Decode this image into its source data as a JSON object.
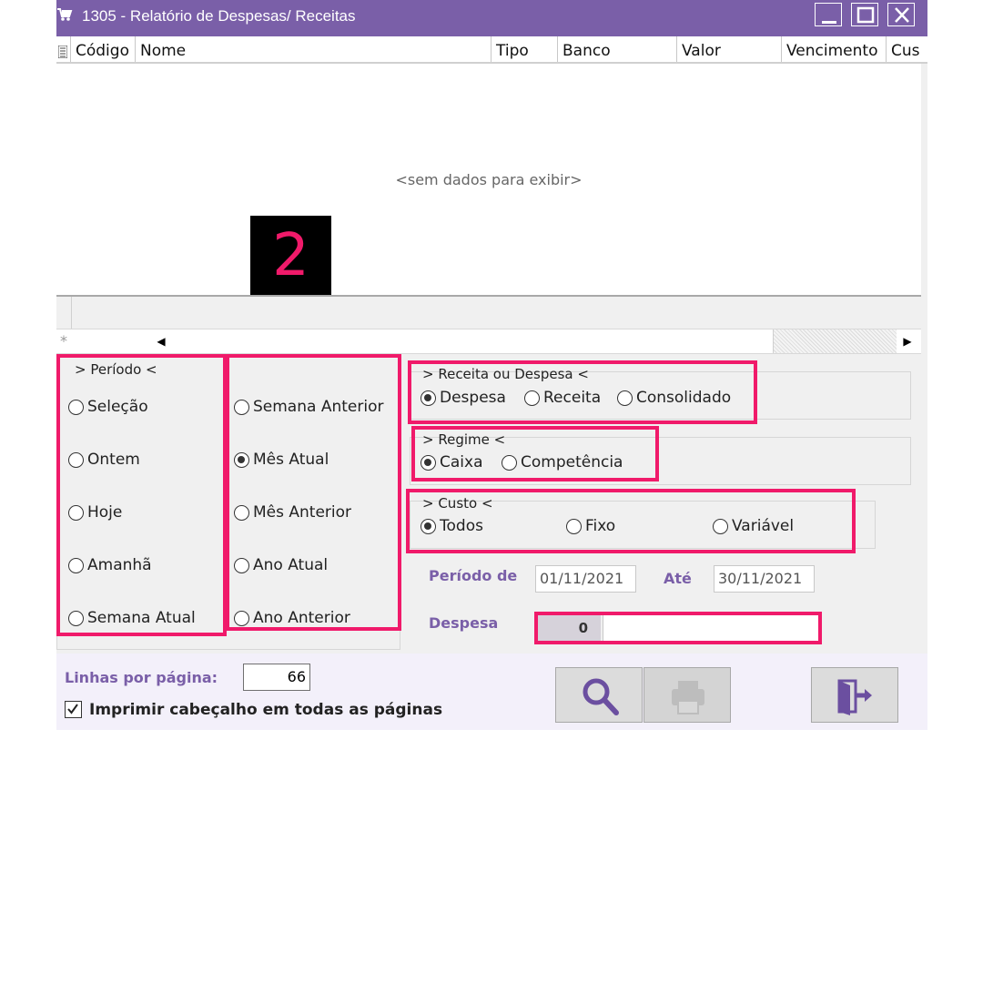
{
  "window": {
    "title": "1305 - Relatório de Despesas/ Receitas",
    "icons": [
      "cart-icon",
      "minimize-icon",
      "maximize-icon",
      "close-icon"
    ]
  },
  "grid": {
    "columns": [
      "Código",
      "Nome",
      "Tipo",
      "Banco",
      "Valor",
      "Vencimento",
      "Cus"
    ],
    "empty_message": "<sem dados para exibir>",
    "marker": "2"
  },
  "periodo": {
    "legend": "> Período <",
    "options_left": [
      "Seleção",
      "Ontem",
      "Hoje",
      "Amanhã",
      "Semana Atual"
    ],
    "options_right": [
      "Semana Anterior",
      "Mês Atual",
      "Mês Anterior",
      "Ano Atual",
      "Ano Anterior"
    ],
    "selected": "Mês Atual"
  },
  "receita_despesa": {
    "legend": "> Receita ou Despesa <",
    "options": [
      "Despesa",
      "Receita",
      "Consolidado"
    ],
    "selected": "Despesa"
  },
  "regime": {
    "legend": "> Regime <",
    "options": [
      "Caixa",
      "Competência"
    ],
    "selected": "Caixa"
  },
  "custo": {
    "legend": "> Custo <",
    "options": [
      "Todos",
      "Fixo",
      "Variável"
    ],
    "selected": "Todos"
  },
  "filters": {
    "periodo_de_label": "Período de",
    "date_from": "01/11/2021",
    "ate_label": "Até",
    "date_to": "30/11/2021",
    "despesa_label": "Despesa",
    "despesa_code": "0",
    "despesa_name": ""
  },
  "bottom": {
    "lines_label": "Linhas por página:",
    "lines_value": "66",
    "print_header_label": "Imprimir cabeçalho em todas as páginas",
    "print_header_checked": true,
    "buttons": [
      "search-icon",
      "print-icon",
      "exit-icon"
    ]
  },
  "colors": {
    "titlebar": "#7a5fa8",
    "label_purple": "#7a5fa8",
    "highlight": "#f01a6a"
  }
}
